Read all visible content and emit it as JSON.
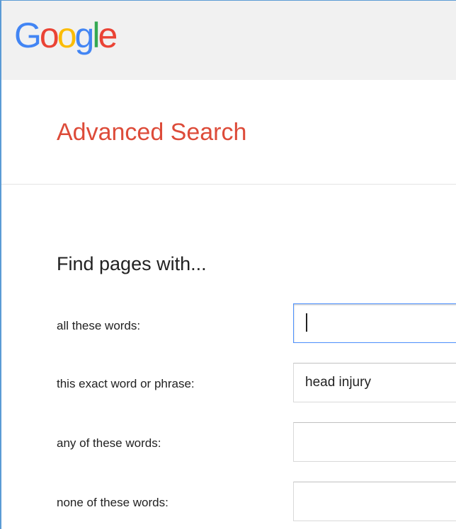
{
  "logo": {
    "letters": [
      "G",
      "o",
      "o",
      "g",
      "l",
      "e"
    ],
    "colors": [
      "#4285f4",
      "#ea4335",
      "#fbbc05",
      "#4285f4",
      "#34a853",
      "#ea4335"
    ]
  },
  "page": {
    "title": "Advanced Search",
    "title_color": "#dd4b39"
  },
  "find_section": {
    "heading": "Find pages with...",
    "rows": [
      {
        "label": "all these words:",
        "value": ""
      },
      {
        "label": "this exact word or phrase:",
        "value": "head injury"
      },
      {
        "label": "any of these words:",
        "value": ""
      },
      {
        "label": "none of these words:",
        "value": ""
      }
    ]
  },
  "colors": {
    "focus_border": "#4d90fe",
    "top_bar": "#f1f1f1"
  }
}
